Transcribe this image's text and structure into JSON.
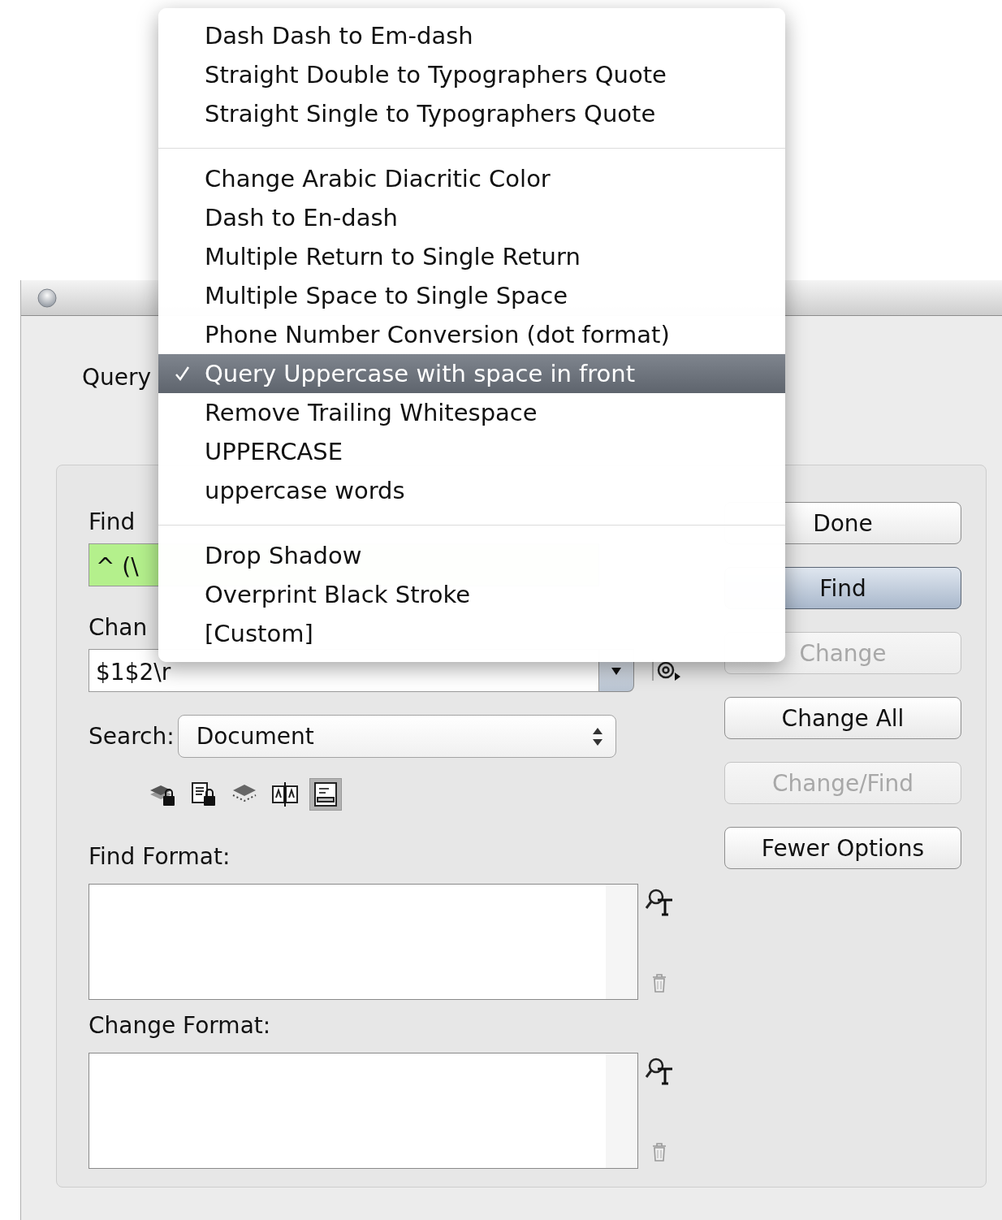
{
  "menu": {
    "groups": [
      {
        "items": [
          {
            "label": "Dash Dash to Em-dash",
            "selected": false
          },
          {
            "label": "Straight Double to Typographers Quote",
            "selected": false
          },
          {
            "label": "Straight Single to Typographers Quote",
            "selected": false
          }
        ]
      },
      {
        "items": [
          {
            "label": "Change Arabic Diacritic Color",
            "selected": false
          },
          {
            "label": "Dash to En-dash",
            "selected": false
          },
          {
            "label": "Multiple Return to Single Return",
            "selected": false
          },
          {
            "label": "Multiple Space to Single Space",
            "selected": false
          },
          {
            "label": "Phone Number Conversion (dot format)",
            "selected": false
          },
          {
            "label": "Query Uppercase with space in front",
            "selected": true
          },
          {
            "label": "Remove Trailing Whitespace",
            "selected": false
          },
          {
            "label": "UPPERCASE",
            "selected": false
          },
          {
            "label": "uppercase words",
            "selected": false
          }
        ]
      },
      {
        "items": [
          {
            "label": "Drop Shadow",
            "selected": false
          },
          {
            "label": "Overprint Black Stroke",
            "selected": false
          },
          {
            "label": "[Custom]",
            "selected": false
          }
        ]
      }
    ]
  },
  "dialog": {
    "query_label": "Query",
    "find_what": {
      "label": "Find",
      "value": "^ (\\"
    },
    "change_to": {
      "label": "Chan",
      "value": "$1$2\\r"
    },
    "search": {
      "label": "Search:",
      "value": "Document"
    },
    "search_options": [
      {
        "kind": "layers_lock",
        "selected": false
      },
      {
        "kind": "document_lock",
        "selected": false
      },
      {
        "kind": "layers_dotted",
        "selected": false
      },
      {
        "kind": "book",
        "selected": false
      },
      {
        "kind": "text_box",
        "selected": true
      }
    ],
    "find_format": {
      "label": "Find Format:"
    },
    "change_format": {
      "label": "Change Format:"
    },
    "buttons": [
      {
        "label": "Done",
        "default": false,
        "disabled": false
      },
      {
        "label": "Find",
        "default": true,
        "disabled": false
      },
      {
        "label": "Change",
        "default": false,
        "disabled": true
      },
      {
        "label": "Change All",
        "default": false,
        "disabled": false
      },
      {
        "label": "Change/Find",
        "default": false,
        "disabled": true
      },
      {
        "label": "Fewer Options",
        "default": false,
        "disabled": false
      }
    ]
  }
}
